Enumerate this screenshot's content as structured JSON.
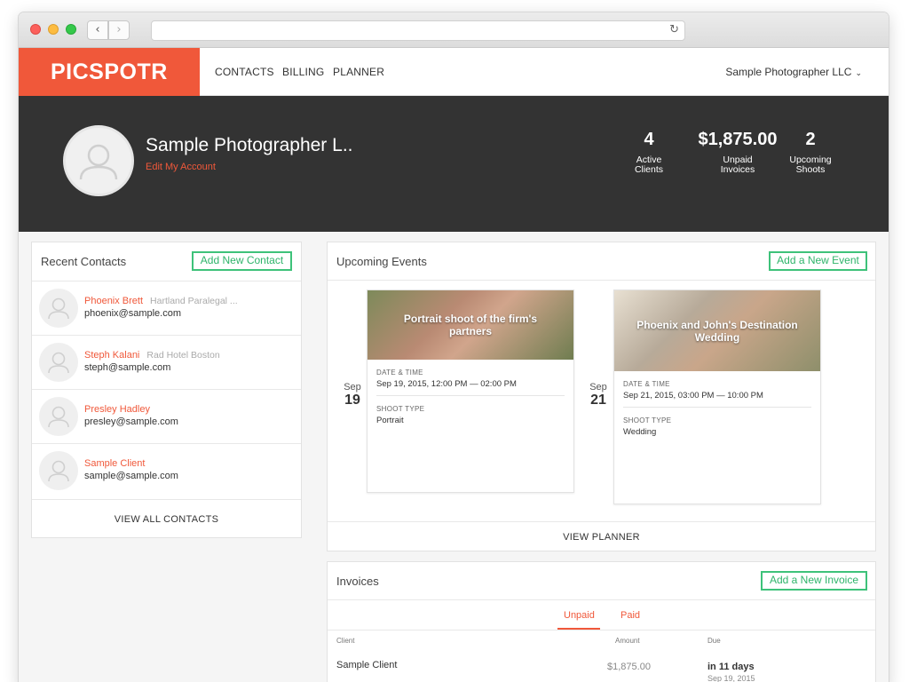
{
  "app": {
    "logo": "PICSPOTR",
    "nav": [
      "CONTACTS",
      "BILLING",
      "PLANNER"
    ],
    "account_menu": "Sample Photographer LLC"
  },
  "profile": {
    "name": "Sample Photographer L..",
    "edit_link": "Edit My Account",
    "stats": [
      {
        "value": "4",
        "label_line1": "Active",
        "label_line2": "Clients"
      },
      {
        "value": "$1,875.00",
        "label_line1": "Unpaid",
        "label_line2": "Invoices"
      },
      {
        "value": "2",
        "label_line1": "Upcoming",
        "label_line2": "Shoots"
      }
    ]
  },
  "contacts": {
    "title": "Recent Contacts",
    "add_button": "Add New Contact",
    "items": [
      {
        "name": "Phoenix Brett",
        "company": "Hartland Paralegal ...",
        "email": "phoenix@sample.com"
      },
      {
        "name": "Steph Kalani",
        "company": "Rad Hotel Boston",
        "email": "steph@sample.com"
      },
      {
        "name": "Presley Hadley",
        "company": "",
        "email": "presley@sample.com"
      },
      {
        "name": "Sample Client",
        "company": "",
        "email": "sample@sample.com"
      }
    ],
    "view_all": "VIEW ALL CONTACTS"
  },
  "events": {
    "title": "Upcoming Events",
    "add_button": "Add a New Event",
    "items": [
      {
        "month": "Sep",
        "day": "19",
        "title": "Portrait shoot of the firm's partners",
        "date_label": "DATE & TIME",
        "date_value": "Sep 19, 2015, 12:00 PM — 02:00 PM",
        "type_label": "SHOOT TYPE",
        "type_value": "Portrait"
      },
      {
        "month": "Sep",
        "day": "21",
        "title": "Phoenix and John's Destination Wedding",
        "date_label": "DATE & TIME",
        "date_value": "Sep 21, 2015, 03:00 PM — 10:00 PM",
        "type_label": "SHOOT TYPE",
        "type_value": "Wedding"
      }
    ],
    "view_planner": "VIEW PLANNER"
  },
  "invoices": {
    "title": "Invoices",
    "add_button": "Add a New Invoice",
    "tabs": [
      "Unpaid",
      "Paid"
    ],
    "columns": [
      "Client",
      "Amount",
      "Due"
    ],
    "rows": [
      {
        "client": "Sample Client",
        "amount": "$1,875.00",
        "due": "in 11 days",
        "due_date": "Sep 19, 2015"
      }
    ]
  },
  "colors": {
    "brand": "#f0583a",
    "accent_green": "#3ec27a",
    "banner": "#333333"
  }
}
